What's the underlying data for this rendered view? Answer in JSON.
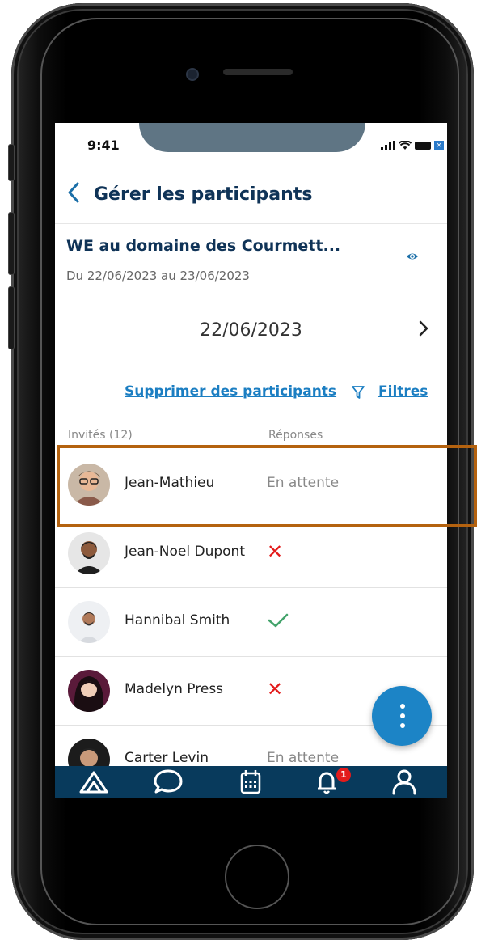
{
  "status_bar": {
    "time": "9:41"
  },
  "header": {
    "back_icon": "chevron-left-icon",
    "title": "Gérer les participants"
  },
  "event": {
    "title": "WE au domaine des Courmett...",
    "dates": "Du 22/06/2023 au 23/06/2023",
    "preview_icon": "eye-icon"
  },
  "date_nav": {
    "date": "22/06/2023",
    "next_icon": "chevron-right-icon"
  },
  "actions": {
    "delete_label": "Supprimer des participants",
    "filter_label": "Filtres",
    "filter_icon": "filter-icon"
  },
  "list": {
    "col_invited": "Invités (12)",
    "col_responses": "Réponses",
    "rows": [
      {
        "name": "Jean-Mathieu",
        "response_text": "En attente",
        "response": "pending"
      },
      {
        "name": "Jean-Noel Dupont",
        "response_text": "",
        "response": "declined"
      },
      {
        "name": "Hannibal Smith",
        "response_text": "",
        "response": "accepted"
      },
      {
        "name": "Madelyn Press",
        "response_text": "",
        "response": "declined"
      },
      {
        "name": "Carter Levin",
        "response_text": "En attente",
        "response": "pending"
      }
    ]
  },
  "tabbar": {
    "items": [
      "tent-icon",
      "chat-icon",
      "calendar-icon",
      "bell-icon",
      "user-icon"
    ],
    "notification_badge": "1"
  },
  "colors": {
    "primary": "#0f3357",
    "link": "#1b7ec2",
    "tabbar": "#083a5c",
    "highlight": "#b4620f",
    "declined": "#e31b1b",
    "accepted": "#43a36b"
  }
}
